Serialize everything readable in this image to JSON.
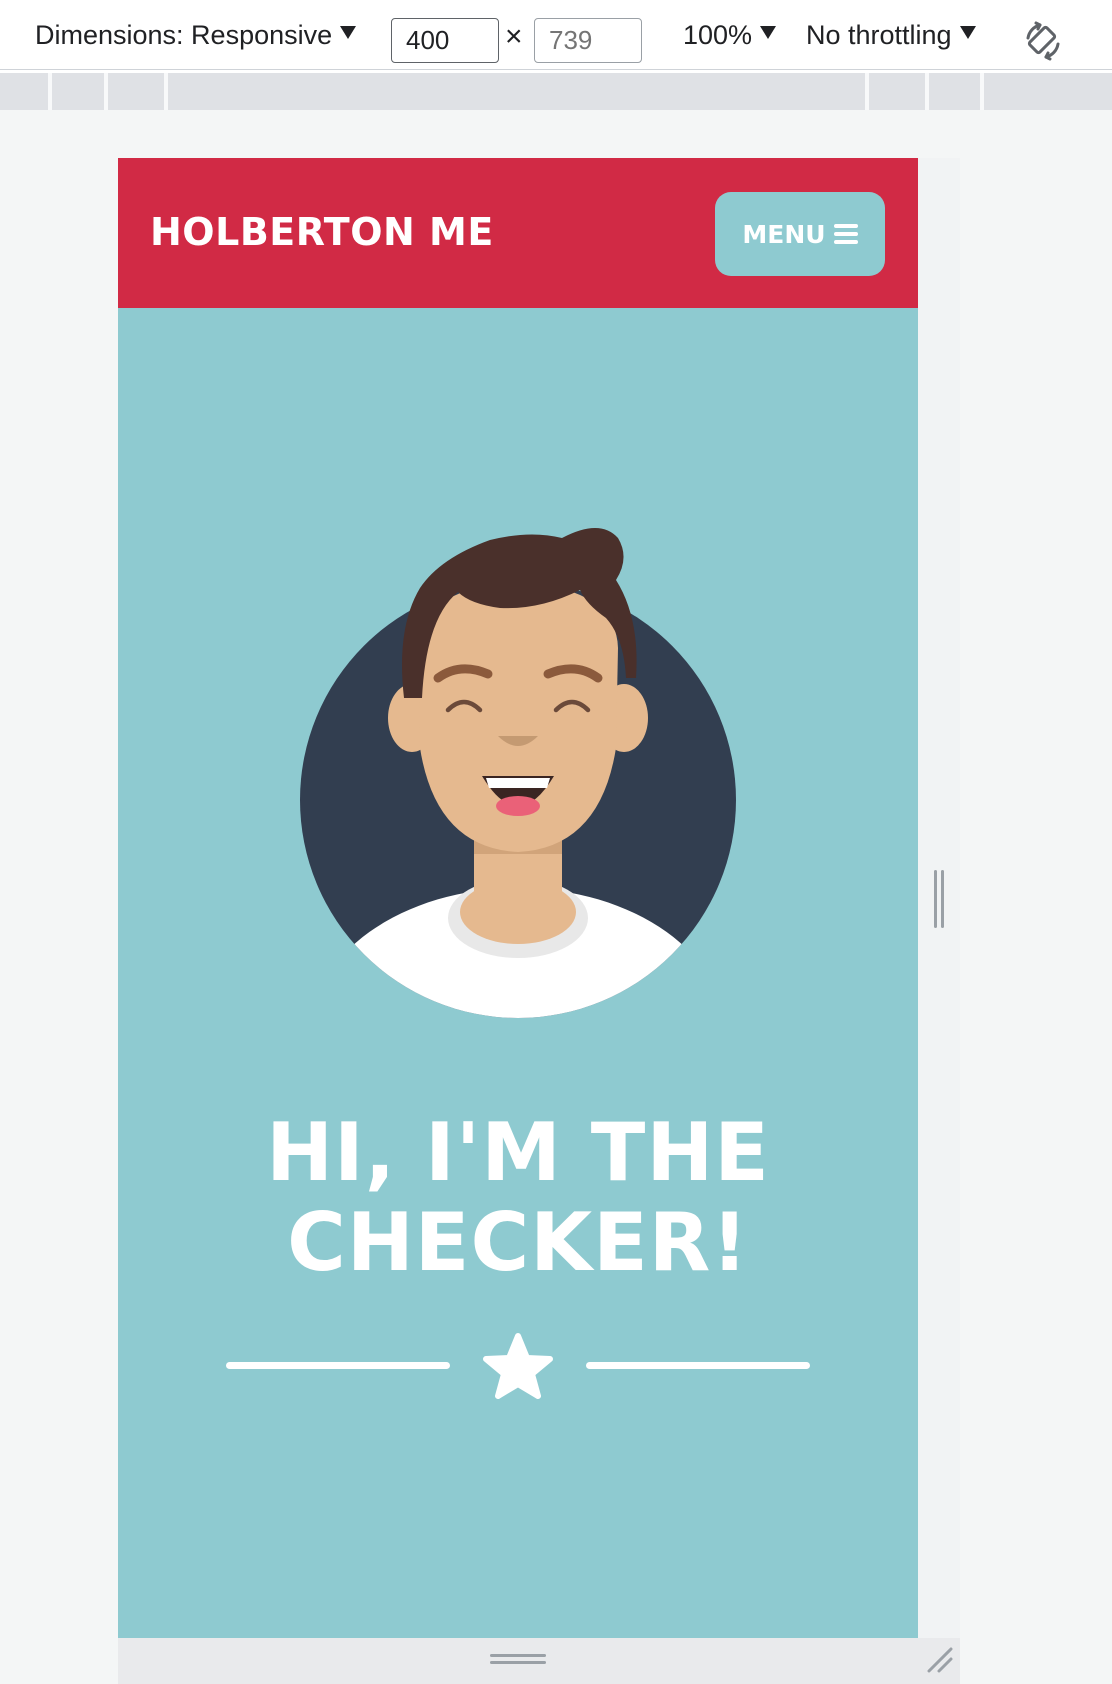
{
  "devtools": {
    "dimensions_label": "Dimensions: Responsive",
    "width_value": "400",
    "height_placeholder": "739",
    "times_symbol": "×",
    "zoom": "100%",
    "throttling": "No throttling",
    "rotate_icon": "rotate-icon"
  },
  "site": {
    "brand": "HOLBERTON ME",
    "menu_label": "MENU",
    "menu_icon": "hamburger-icon",
    "hero_title_line1": "HI, I'M THE",
    "hero_title_line2": "CHECKER!",
    "divider_icon": "star-icon"
  },
  "colors": {
    "header_red": "#d12a45",
    "teal": "#8ecad0",
    "avatar_circle": "#323e50",
    "hair": "#4a302b",
    "skin": "#e5b98f",
    "white": "#ffffff"
  }
}
